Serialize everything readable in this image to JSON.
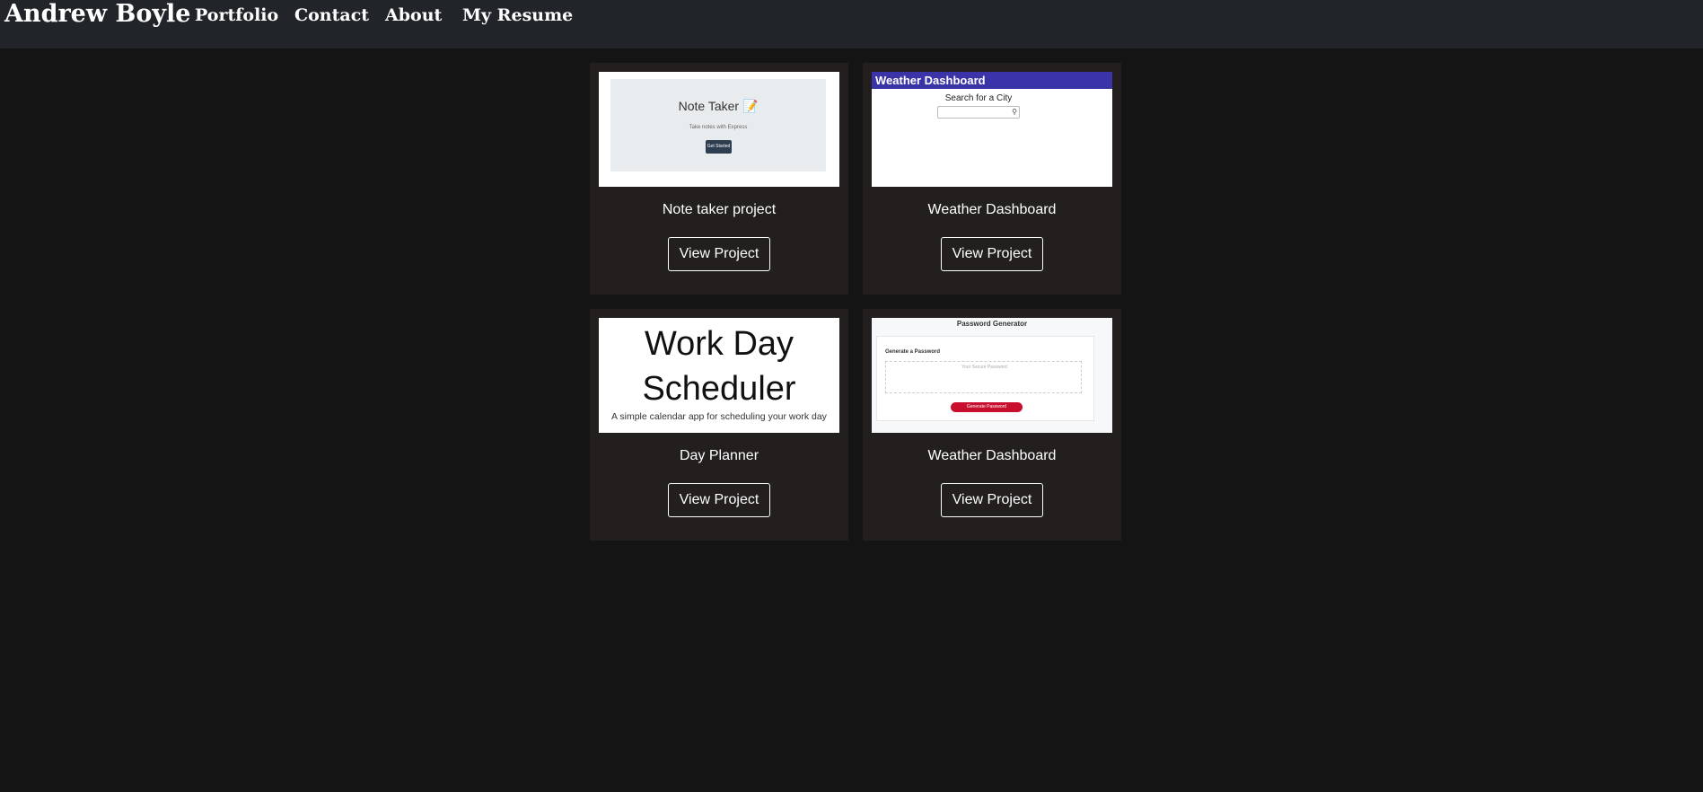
{
  "nav": {
    "brand": "Andrew Boyle",
    "links": [
      "Portfolio",
      "Contact",
      "About",
      "My Resume"
    ]
  },
  "projects": [
    {
      "title": "Note taker project",
      "button": "View Project",
      "thumbnail": {
        "heading": "Note Taker",
        "icon": "notepad-emoji",
        "subtitle": "Take notes with Express",
        "button": "Get Started"
      }
    },
    {
      "title": "Weather Dashboard",
      "button": "View Project",
      "thumbnail": {
        "header": "Weather Dashboard",
        "search_label": "Search for a City",
        "search_icon": "search-icon",
        "header_color": "#3a34a8"
      }
    },
    {
      "title": "Day Planner",
      "button": "View Project",
      "thumbnail": {
        "heading_line1": "Work Day",
        "heading_line2": "Scheduler",
        "subtitle": "A simple calendar app for scheduling your work day"
      }
    },
    {
      "title": "Weather Dashboard",
      "button": "View Project",
      "thumbnail": {
        "heading": "Password Generator",
        "card_title": "Generate a Password",
        "placeholder": "Your Secure Password",
        "button": "Generate Password",
        "button_color": "#c8102e"
      }
    }
  ]
}
